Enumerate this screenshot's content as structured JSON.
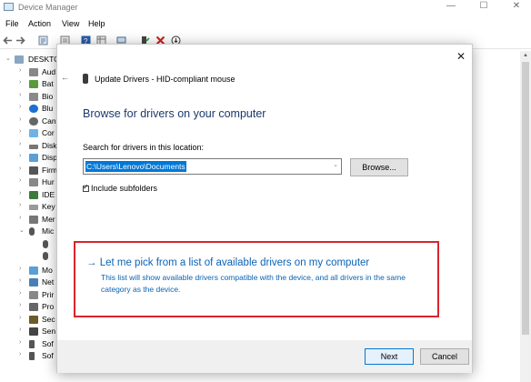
{
  "window": {
    "title": "Device Manager",
    "controls": {
      "minimize": "—",
      "maximize": "☐",
      "close": "✕"
    }
  },
  "menu": [
    "File",
    "Action",
    "View",
    "Help"
  ],
  "toolbar_icons": [
    "back-arrow-icon",
    "forward-arrow-icon",
    "properties-icon",
    "show-hidden-icon",
    "help-icon",
    "view-icon",
    "scan-hardware-icon",
    "update-driver-icon",
    "uninstall-icon",
    "disable-icon"
  ],
  "tree": {
    "root": "DESKTO",
    "items": [
      "Aud",
      "Bat",
      "Bio",
      "Blu",
      "Can",
      "Cor",
      "Disk",
      "Disp",
      "Firm",
      "Hur",
      "IDE",
      "Key",
      "Mer",
      "Mic",
      "Mo",
      "Net",
      "Prir",
      "Pro",
      "Sec",
      "Sen",
      "Sof",
      "Sof"
    ]
  },
  "dialog": {
    "header_title": "Update Drivers - HID-compliant mouse",
    "heading": "Browse for drivers on your computer",
    "search_label": "Search for drivers in this location:",
    "path_value": "C:\\Users\\Lenovo\\Documents",
    "browse_label": "Browse...",
    "include_subfolders_label": "Include subfolders",
    "include_subfolders_checked": true,
    "pick_title": "→  Let me pick from a list of available drivers on my computer",
    "pick_description": "This list will show available drivers compatible with the device, and all drivers in the same category as the device.",
    "next_label": "Next",
    "cancel_label": "Cancel",
    "highlight_color": "#d9252a",
    "link_color": "#0a63b6"
  }
}
